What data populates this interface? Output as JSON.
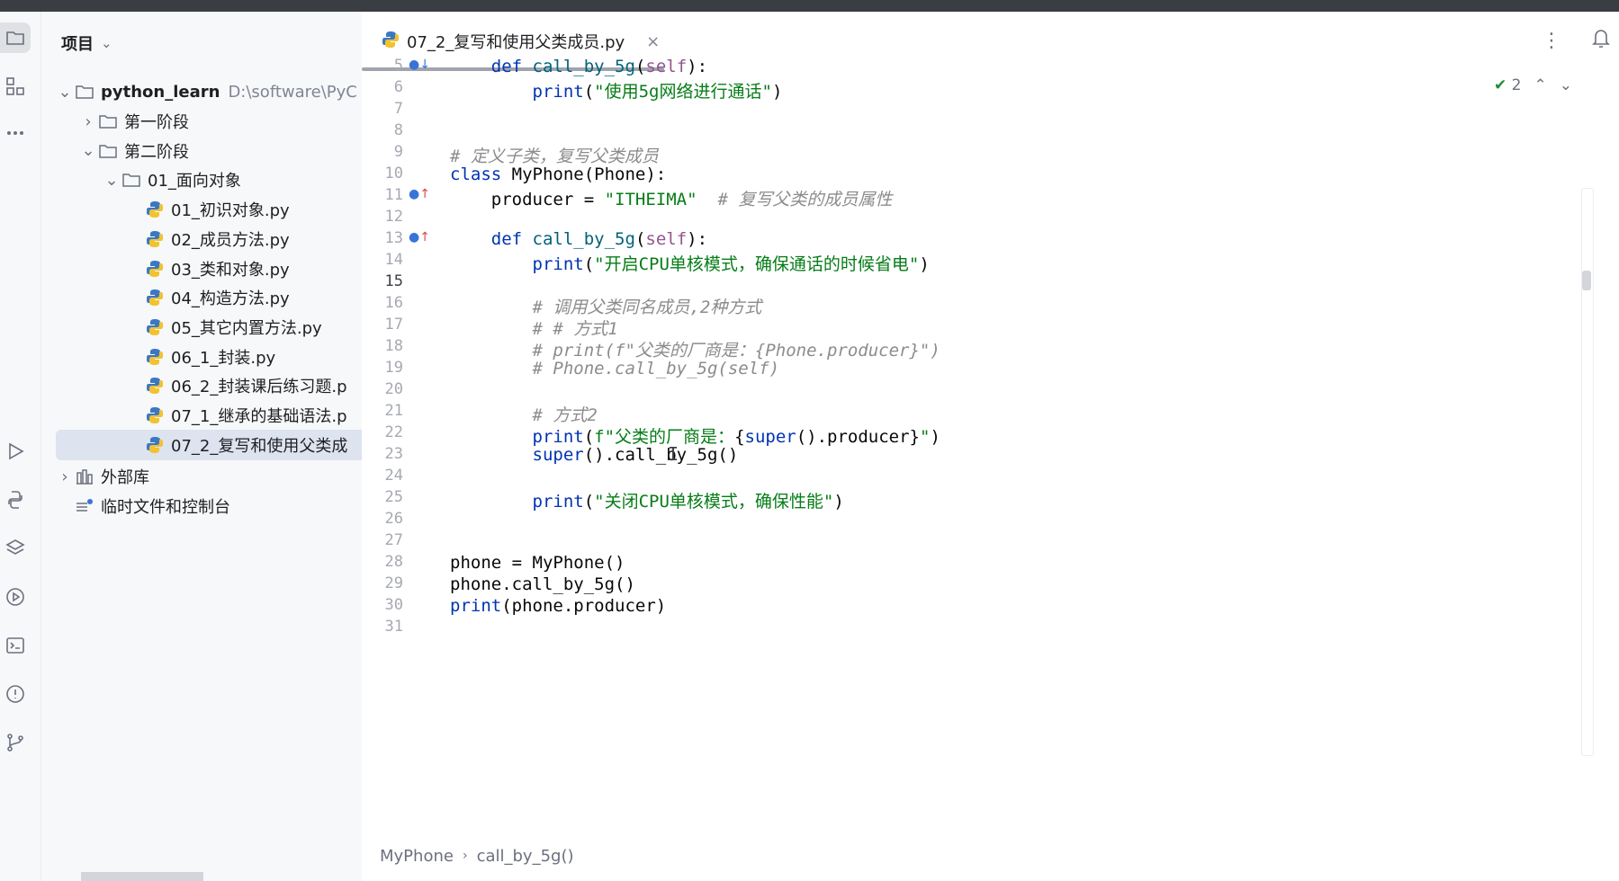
{
  "project": {
    "header": "项目",
    "root": {
      "name": "python_learn",
      "path": "D:\\software\\PyC"
    },
    "items": [
      {
        "label": "第一阶段",
        "type": "folder",
        "depth": 1,
        "expanded": false
      },
      {
        "label": "第二阶段",
        "type": "folder",
        "depth": 1,
        "expanded": true
      },
      {
        "label": "01_面向对象",
        "type": "folder",
        "depth": 2,
        "expanded": true
      },
      {
        "label": "01_初识对象.py",
        "type": "py",
        "depth": 3
      },
      {
        "label": "02_成员方法.py",
        "type": "py",
        "depth": 3
      },
      {
        "label": "03_类和对象.py",
        "type": "py",
        "depth": 3
      },
      {
        "label": "04_构造方法.py",
        "type": "py",
        "depth": 3
      },
      {
        "label": "05_其它内置方法.py",
        "type": "py",
        "depth": 3
      },
      {
        "label": "06_1_封装.py",
        "type": "py",
        "depth": 3
      },
      {
        "label": "06_2_封装课后练习题.p",
        "type": "py",
        "depth": 3
      },
      {
        "label": "07_1_继承的基础语法.p",
        "type": "py",
        "depth": 3
      },
      {
        "label": "07_2_复写和使用父类成",
        "type": "py",
        "depth": 3,
        "selected": true
      }
    ],
    "external": "外部库",
    "scratches": "临时文件和控制台"
  },
  "editor": {
    "tab_title": "07_2_复写和使用父类成员.py",
    "inspection_count": "2",
    "breadcrumb": [
      "MyPhone",
      "call_by_5g()"
    ],
    "current_line": 15,
    "lines": [
      {
        "n": "5",
        "marker": "override-down",
        "html": "    <span class='kw'>def</span> <span class='fn'>call_by_5g</span>(<span class='self'>self</span>):"
      },
      {
        "n": "6",
        "html": "        <span class='builtin'>print</span>(<span class='str'>\"使用5g网络进行通话\"</span>)"
      },
      {
        "n": "7",
        "html": ""
      },
      {
        "n": "8",
        "html": ""
      },
      {
        "n": "9",
        "html": "<span class='com'># 定义子类，复写父类成员</span>"
      },
      {
        "n": "10",
        "html": "<span class='kw'>class</span> MyPhone(Phone):"
      },
      {
        "n": "11",
        "marker": "override-up",
        "html": "    producer = <span class='str'>\"ITHEIMA\"</span>  <span class='com'># 复写父类的成员属性</span>"
      },
      {
        "n": "12",
        "html": ""
      },
      {
        "n": "13",
        "marker": "override-up",
        "html": "    <span class='kw'>def</span> <span class='fn'>call_by_5g</span>(<span class='self'>self</span>):"
      },
      {
        "n": "14",
        "html": "        <span class='builtin'>print</span>(<span class='str'>\"开启CPU单核模式，确保通话的时候省电\"</span>)"
      },
      {
        "n": "15",
        "html": ""
      },
      {
        "n": "16",
        "html": "        <span class='com'># 调用父类同名成员,2种方式</span>"
      },
      {
        "n": "17",
        "html": "        <span class='com'># # 方式1</span>"
      },
      {
        "n": "18",
        "html": "        <span class='com'># print(f\"父类的厂商是：{Phone.producer}\")</span>"
      },
      {
        "n": "19",
        "html": "        <span class='com'># Phone.call_by_5g(self)</span>"
      },
      {
        "n": "20",
        "html": ""
      },
      {
        "n": "21",
        "html": "        <span class='com'># 方式2</span>"
      },
      {
        "n": "22",
        "html": "        <span class='builtin'>print</span>(<span class='str'>f\"父类的厂商是：</span>{<span class='builtin'>super</span>().producer}<span class='str'>\"</span>)"
      },
      {
        "n": "23",
        "html": "        <span class='builtin'>super</span>().call_by_5g()"
      },
      {
        "n": "24",
        "html": ""
      },
      {
        "n": "25",
        "html": "        <span class='builtin'>print</span>(<span class='str'>\"关闭CPU单核模式，确保性能\"</span>)"
      },
      {
        "n": "26",
        "html": ""
      },
      {
        "n": "27",
        "html": ""
      },
      {
        "n": "28",
        "html": "phone = MyPhone()"
      },
      {
        "n": "29",
        "html": "phone.call_by_5g()"
      },
      {
        "n": "30",
        "html": "<span class='builtin'>print</span>(phone.producer)"
      },
      {
        "n": "31",
        "html": ""
      }
    ]
  }
}
